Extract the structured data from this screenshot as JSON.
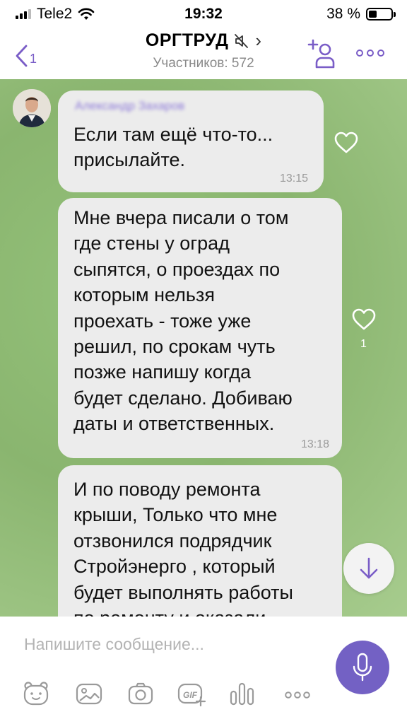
{
  "status_bar": {
    "carrier": "Tele2",
    "time": "19:32",
    "battery_percent": "38 %",
    "battery_level": 0.38
  },
  "header": {
    "back_count": "1",
    "title": "ОРГТРУД",
    "chevron": "›",
    "subtitle": "Участников: 572",
    "icons": [
      "back-arrow-icon",
      "mute-icon",
      "add-member-icon",
      "more-icon"
    ]
  },
  "messages": [
    {
      "sender": "Александр Захаров",
      "text": [
        "Если там ещё что-то...",
        "присылайте."
      ],
      "time": "13:15",
      "likes": ""
    },
    {
      "text": [
        "Мне вчера писали о том",
        "где стены у оград",
        "сыпятся, о проездах по",
        "которым нельзя",
        "проехать - тоже уже",
        "решил, по срокам чуть",
        "позже напишу когда",
        "будет сделано. Добиваю",
        "даты и ответственных."
      ],
      "time": "13:18",
      "likes": "1"
    },
    {
      "text": [
        "И по поводу ремонта",
        "крыши, Только что мне",
        "отзвонился подрядчик",
        "Стройэнерго , который",
        "будет выполнять работы",
        "по ремонту и оказали"
      ]
    }
  ],
  "composer": {
    "placeholder": "Напишите сообщение...",
    "gif_label": "GIF",
    "tools": [
      "sticker-icon",
      "gallery-icon",
      "camera-icon",
      "gif-icon",
      "poll-icon",
      "more-icon"
    ]
  },
  "colors": {
    "accent": "#7a5dc7",
    "mic_button": "#7361c4",
    "chat_background": "#8ab56f",
    "bubble": "#ececec"
  }
}
